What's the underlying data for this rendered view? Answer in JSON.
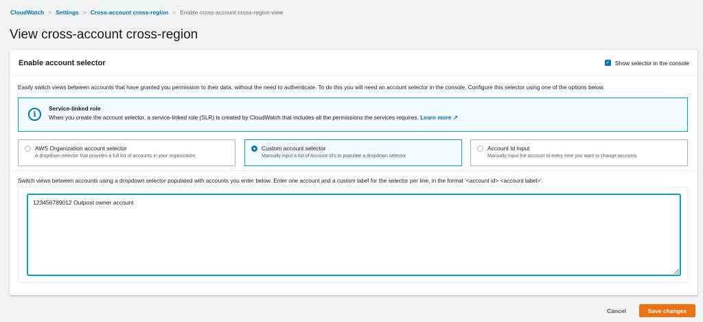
{
  "breadcrumb": [
    "CloudWatch",
    "Settings",
    "Cross-account cross-region",
    "Enable cross-account cross-region view"
  ],
  "page_title": "View cross-account cross-region",
  "card": {
    "title": "Enable account selector",
    "show_selector_label": "Show selector in the console",
    "show_selector_checked": true,
    "description": "Easily switch views between accounts that have granted you permission to their data, without the need to authenticate. To do this you will need an account selector in the console. Configure this selector using one of the options below.",
    "info": {
      "title": "Service-linked role",
      "text": "When you create the account selector, a service-linked role (SLR) is created by CloudWatch that includes all the permissions the services requires.",
      "link": "Learn more"
    },
    "options": [
      {
        "title": "AWS Organization account selector",
        "sub": "A dropdown selector that provides a full list of accounts in your organization",
        "selected": false
      },
      {
        "title": "Custom account selector",
        "sub": "Manually input a list of Account Id's to populate a dropdown selector",
        "selected": true
      },
      {
        "title": "Account Id Input",
        "sub": "Manually input the account Id every time you want to change accounts",
        "selected": false
      }
    ],
    "instructions": "Switch views between accounts using a dropdown selector populated with accounts you enter below. Enter one account and a custom label for the selector per line, in the format '<account id> <account label>'.",
    "textarea_value": "123456789012 Outpost owner account"
  },
  "footer": {
    "cancel": "Cancel",
    "save": "Save changes"
  }
}
